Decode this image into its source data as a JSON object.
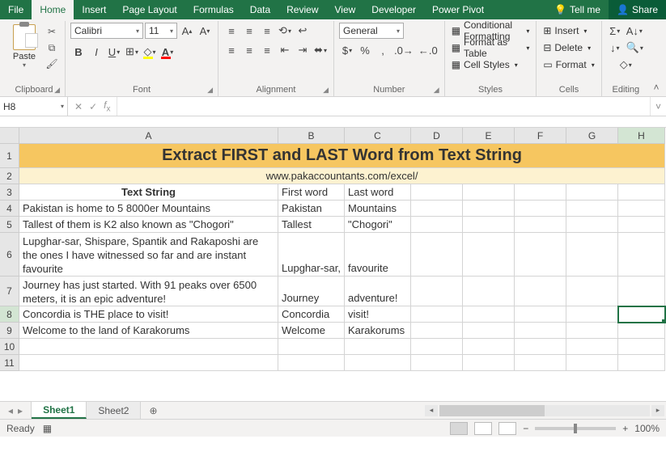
{
  "tabs": {
    "file": "File",
    "home": "Home",
    "insert": "Insert",
    "page_layout": "Page Layout",
    "formulas": "Formulas",
    "data": "Data",
    "review": "Review",
    "view": "View",
    "developer": "Developer",
    "power_pivot": "Power Pivot",
    "tell_me": "Tell me",
    "share": "Share"
  },
  "ribbon": {
    "clipboard": {
      "paste": "Paste",
      "label": "Clipboard"
    },
    "font": {
      "name": "Calibri",
      "size": "11",
      "label": "Font"
    },
    "alignment": {
      "label": "Alignment"
    },
    "number": {
      "format": "General",
      "label": "Number"
    },
    "styles": {
      "conditional": "Conditional Formatting",
      "table": "Format as Table",
      "cell": "Cell Styles",
      "label": "Styles"
    },
    "cells": {
      "insert": "Insert",
      "delete": "Delete",
      "format": "Format",
      "label": "Cells"
    },
    "editing": {
      "label": "Editing"
    }
  },
  "name_box": "H8",
  "formula": "",
  "columns": [
    "A",
    "B",
    "C",
    "D",
    "E",
    "F",
    "G",
    "H"
  ],
  "row1_title": "Extract FIRST and LAST Word from Text String",
  "row2_url": "www.pakaccountants.com/excel/",
  "headers": {
    "a": "Text String",
    "b": "First word",
    "c": "Last word"
  },
  "data_rows": [
    {
      "a": "Pakistan is home to 5 8000er Mountains",
      "b": "Pakistan",
      "c": "Mountains"
    },
    {
      "a": "Tallest of them is K2 also known as \"Chogori\"",
      "b": "Tallest",
      "c": "\"Chogori\""
    },
    {
      "a": "Lupghar-sar, Shispare, Spantik and Rakaposhi are the ones I have witnessed so far and are instant favourite",
      "b": "Lupghar-sar,",
      "c": "favourite"
    },
    {
      "a": "Journey has just started. With 91 peaks over 6500 meters, it is an epic adventure!",
      "b": "Journey",
      "c": "adventure!"
    },
    {
      "a": "Concordia is THE place to visit!",
      "b": "Concordia",
      "c": "visit!"
    },
    {
      "a": "Welcome to the land of Karakorums",
      "b": "Welcome",
      "c": "Karakorums"
    }
  ],
  "sheets": {
    "s1": "Sheet1",
    "s2": "Sheet2"
  },
  "status": {
    "ready": "Ready",
    "zoom": "100%"
  }
}
